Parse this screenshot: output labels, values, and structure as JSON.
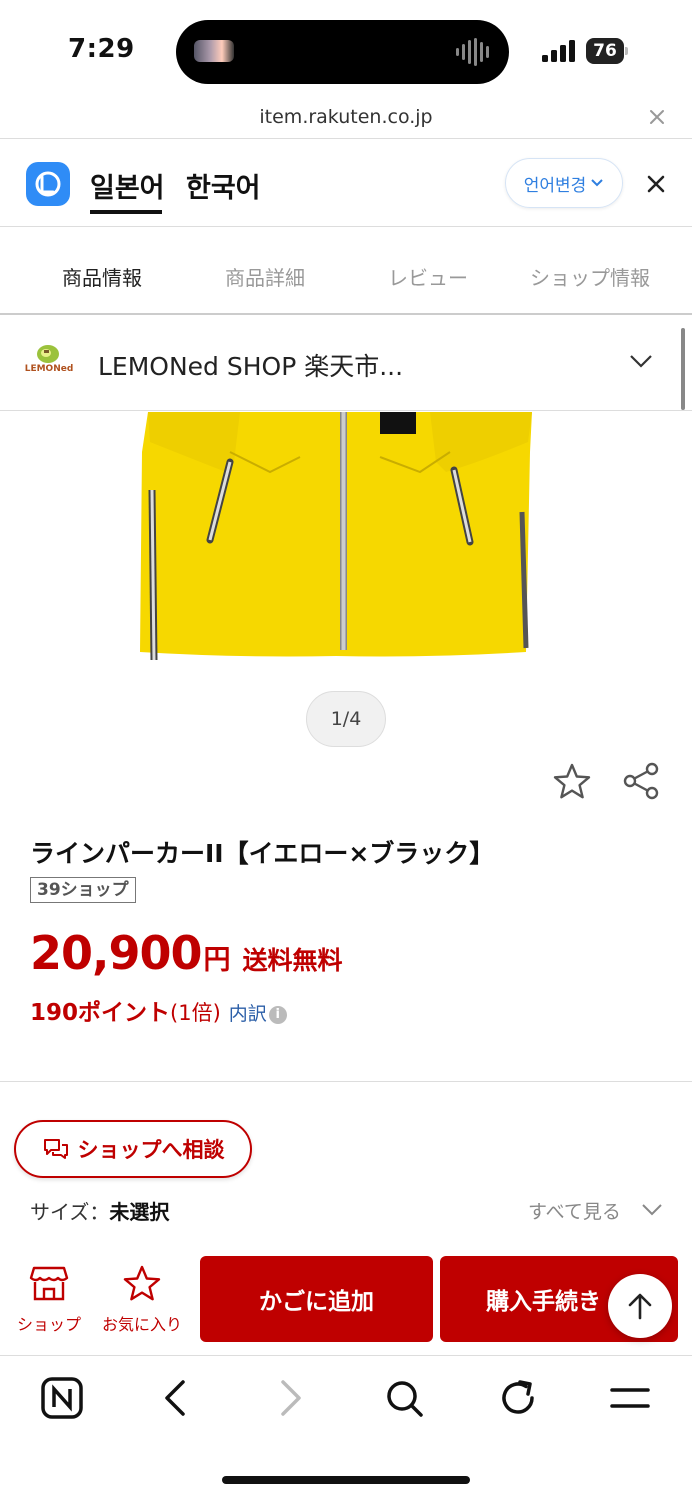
{
  "status": {
    "time": "7:29",
    "battery": "76"
  },
  "browser": {
    "url": "item.rakuten.co.jp"
  },
  "translate": {
    "source_lang": "일본어",
    "target_lang": "한국어",
    "change_label": "언어변경"
  },
  "tabs": [
    {
      "label": "商品情報"
    },
    {
      "label": "商品詳細"
    },
    {
      "label": "レビュー"
    },
    {
      "label": "ショップ情報"
    }
  ],
  "shop": {
    "name": "LEMONed SHOP 楽天市...",
    "logo_text": "LEMONed"
  },
  "gallery": {
    "counter": "1/4"
  },
  "product": {
    "title": "ラインパーカーII【イエロー×ブラック】",
    "badge": "39ショップ",
    "price": "20,900",
    "currency": "円",
    "shipping": "送料無料",
    "points": "190ポイント",
    "points_multiplier": "(1倍)",
    "points_detail": "内訳"
  },
  "consult": {
    "label": "ショップへ相談"
  },
  "size": {
    "label": "サイズ：",
    "value": "未選択",
    "see_all": "すべて見る"
  },
  "actions": {
    "shop_label": "ショップ",
    "favorite_label": "お気に入り",
    "cart_label": "かごに追加",
    "buy_label": "購入手続き"
  },
  "colors": {
    "accent": "#bf0000",
    "link": "#2c5fa8",
    "translate_blue": "#2f8cf6"
  },
  "icons": [
    "star-icon",
    "share-icon",
    "chat-icon",
    "shop-icon",
    "chevron-down-icon",
    "arrow-up-icon",
    "naver-icon",
    "back-icon",
    "forward-icon",
    "search-icon",
    "reload-icon",
    "menu-icon"
  ]
}
